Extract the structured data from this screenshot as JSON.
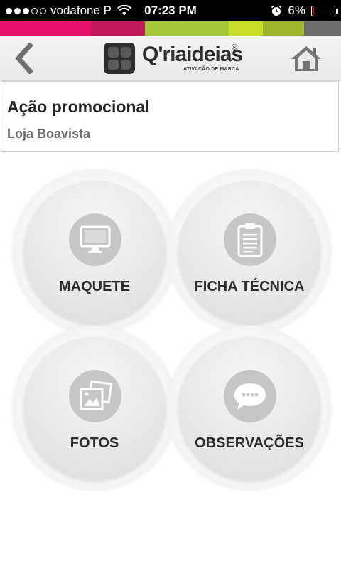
{
  "status_bar": {
    "carrier": "vodafone P",
    "time": "07:23 PM",
    "battery": "6%",
    "battery_level": 0.06,
    "signal_bars_filled": 3,
    "signal_bars_total": 5
  },
  "stripe_colors": [
    "#e8106c",
    "#c2185b",
    "#a4c639",
    "#c7dd28",
    "#9db52a",
    "#6e6e6e"
  ],
  "header": {
    "back_icon": "chevron-left-icon",
    "home_icon": "home-icon",
    "logo": {
      "wordmark": "Q'riaideias",
      "registered": "®",
      "tagline": "ATIVAÇÃO DE MARCA"
    }
  },
  "info": {
    "title": "Ação promocional",
    "subtitle": "Loja Boavista"
  },
  "menu": [
    {
      "label": "MAQUETE",
      "icon": "monitor-icon"
    },
    {
      "label": "FICHA TÉCNICA",
      "icon": "clipboard-icon"
    },
    {
      "label": "FOTOS",
      "icon": "photos-icon"
    },
    {
      "label": "OBSERVAÇÕES",
      "icon": "speech-bubble-icon"
    }
  ]
}
